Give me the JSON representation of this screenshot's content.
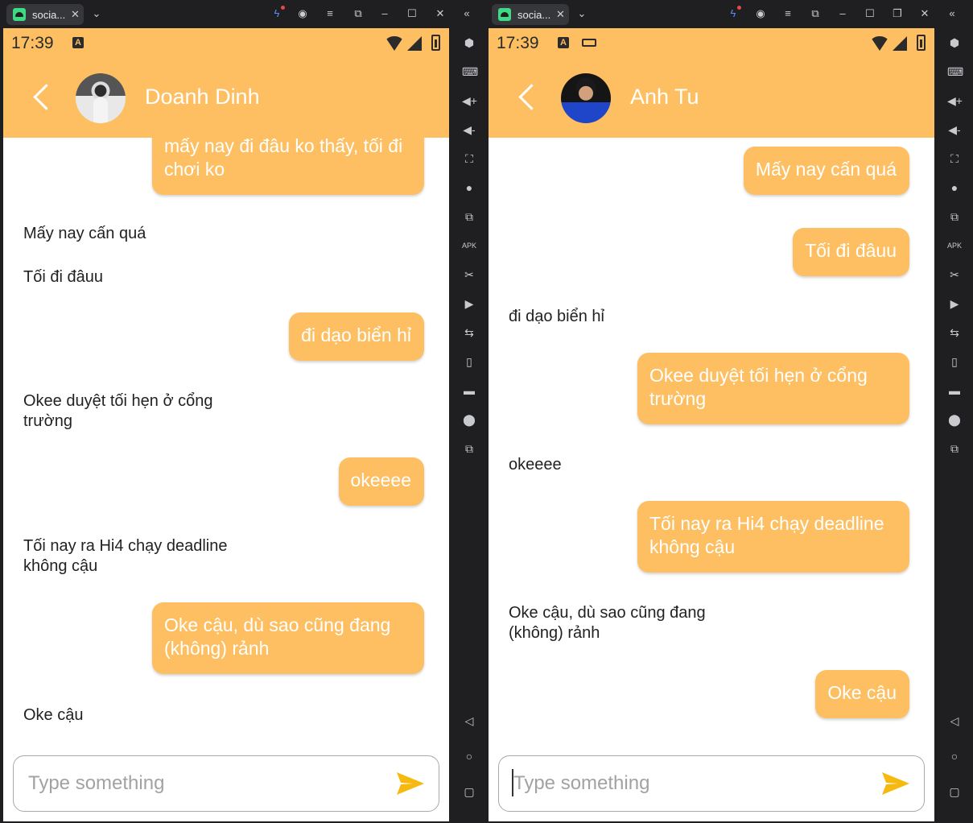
{
  "colors": {
    "accent": "#fdbf61",
    "window_bg": "#1f1f22",
    "bubble_text": "#ffffff",
    "received_text": "#222222",
    "send_icon": "#f5b90f"
  },
  "left": {
    "tab_title": "socia...",
    "status_time": "17:39",
    "contact_name": "Doanh Dinh",
    "input_placeholder": "Type something",
    "messages": [
      {
        "side": "sent",
        "text": "mấy nay đi đâu ko thấy, tối đi chơi ko"
      },
      {
        "side": "received",
        "text": "Mấy nay cấn quá"
      },
      {
        "side": "received",
        "text": "Tối đi đâuu"
      },
      {
        "side": "sent",
        "text": "đi dạo biển hỉ"
      },
      {
        "side": "received",
        "text": "Okee duyệt tối hẹn ở cổng trường"
      },
      {
        "side": "sent",
        "text": "okeeee"
      },
      {
        "side": "received",
        "text": "Tối nay ra Hi4 chạy deadline không cậu"
      },
      {
        "side": "sent",
        "text": "Oke cậu, dù sao cũng đang (không) rảnh"
      },
      {
        "side": "received",
        "text": "Oke cậu"
      }
    ]
  },
  "right": {
    "tab_title": "socia...",
    "status_time": "17:39",
    "contact_name": "Anh Tu",
    "input_placeholder": "Type something",
    "messages": [
      {
        "side": "sent",
        "text": "Mấy nay cấn quá"
      },
      {
        "side": "sent",
        "text": "Tối đi đâuu"
      },
      {
        "side": "received",
        "text": "đi dạo biển hỉ"
      },
      {
        "side": "sent",
        "text": "Okee duyệt tối hẹn ở cổng trường"
      },
      {
        "side": "received",
        "text": "okeeee"
      },
      {
        "side": "sent",
        "text": "Tối nay ra Hi4 chạy deadline không cậu"
      },
      {
        "side": "received",
        "text": "Oke cậu, dù sao cũng đang (không) rảnh"
      },
      {
        "side": "sent",
        "text": "Oke cậu"
      }
    ]
  },
  "icons": {
    "titlebar": [
      "boost-icon",
      "account-icon",
      "menu-icon",
      "restore-screen-icon",
      "minimize-icon",
      "maximize-icon",
      "close-icon",
      "collapse-sidebar-icon"
    ],
    "sidebar": [
      "settings-hex-icon",
      "keyboard-icon",
      "volume-up-icon",
      "volume-down-icon",
      "screenshot-icon",
      "install-icon",
      "multi-instance-icon",
      "apk-icon",
      "cut-icon",
      "record-icon",
      "sync-icon",
      "shake-icon",
      "folder-icon",
      "location-icon",
      "rotate-icon",
      "nav-back-icon",
      "nav-home-icon",
      "nav-recents-icon"
    ]
  }
}
